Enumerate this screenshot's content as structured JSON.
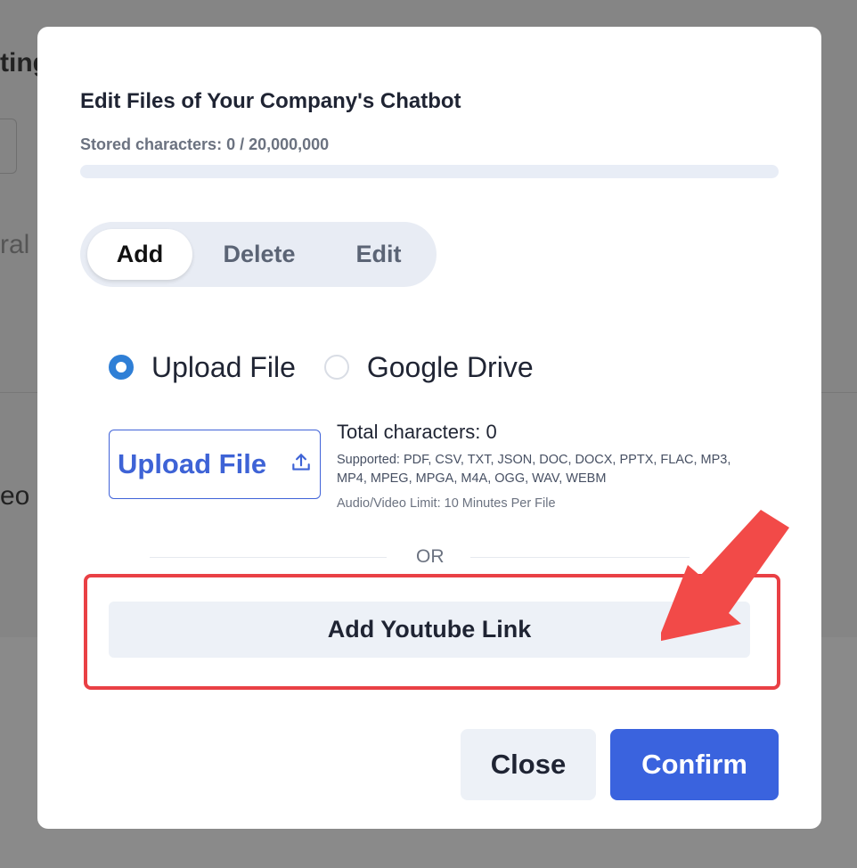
{
  "background": {
    "fragment_1": "ting",
    "fragment_2": "ral",
    "fragment_3": "eo"
  },
  "modal": {
    "title": "Edit Files of Your Company's Chatbot",
    "stored_characters": "Stored characters: 0 / 20,000,000",
    "storage_used_fraction": 0,
    "tabs": [
      {
        "label": "Add",
        "active": true
      },
      {
        "label": "Delete",
        "active": false
      },
      {
        "label": "Edit",
        "active": false
      }
    ],
    "source_options": [
      {
        "label": "Upload File",
        "selected": true
      },
      {
        "label": "Google Drive",
        "selected": false
      }
    ],
    "upload": {
      "button_label": "Upload File",
      "icon": "upload-icon",
      "total_characters": "Total characters: 0",
      "supported": "Supported: PDF, CSV, TXT, JSON, DOC, DOCX, PPTX, FLAC, MP3, MP4, MPEG, MPGA, M4A, OGG, WAV, WEBM",
      "limit": "Audio/Video Limit: 10 Minutes Per File"
    },
    "or_label": "OR",
    "youtube_button": "Add Youtube Link",
    "close_button": "Close",
    "confirm_button": "Confirm"
  },
  "colors": {
    "accent": "#3a63de",
    "highlight": "#e94045",
    "radio_selected": "#2f7fd6"
  }
}
